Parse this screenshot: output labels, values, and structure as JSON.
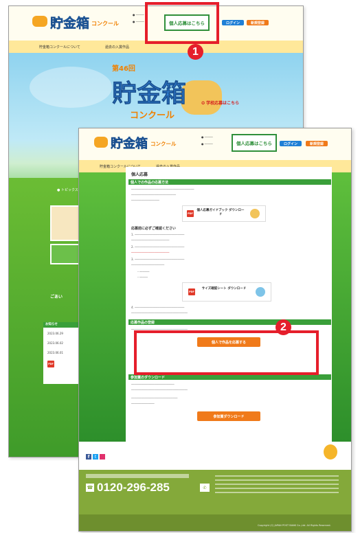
{
  "back_page": {
    "logo_title": "貯金箱",
    "logo_sub": "コンクール",
    "apply_button": "個人応募はこちら",
    "login_button": "ログイン",
    "register_button": "新規登録",
    "nav_items": [
      "貯金箱コンクールについて",
      "過去の入賞作品"
    ],
    "hero_subtitle": "第46回",
    "hero_title": "貯金箱",
    "hero_title2": "コンクール",
    "school_apply": "学校応募はこちら",
    "topics_label": "トピックス",
    "news_label": "お知らせ",
    "dates": [
      "2023.06.29",
      "2023.06.02",
      "2023.06.01"
    ],
    "notice_label": "ごあい"
  },
  "front_page": {
    "logo_title": "貯金箱",
    "logo_sub": "コンクール",
    "apply_button": "個人応募はこちら",
    "login_button": "ログイン",
    "register_button": "新規登録",
    "nav_items": [
      "貯金箱コンクールについて",
      "過去の入賞作品"
    ],
    "panel_title": "個人応募",
    "section1_title": "個人での作品の応募方法",
    "guide_download": "個人応募ガイドブック ダウンロード",
    "confirm_heading": "応募前に必ずご確認ください",
    "size_sheet_download": "サイズ確認シート ダウンロード",
    "section2_title": "応募作品の登録",
    "register_work_button": "個人で作品を応募する",
    "section3_title": "参加賞のダウンロード",
    "participation_button": "参加賞ダウンロード",
    "phone": "0120-296-285",
    "copyright": "Copyright (C) JAPAN POST BANK Co.,Ltd. All Rights Reserved."
  },
  "callouts": [
    "1",
    "2"
  ]
}
